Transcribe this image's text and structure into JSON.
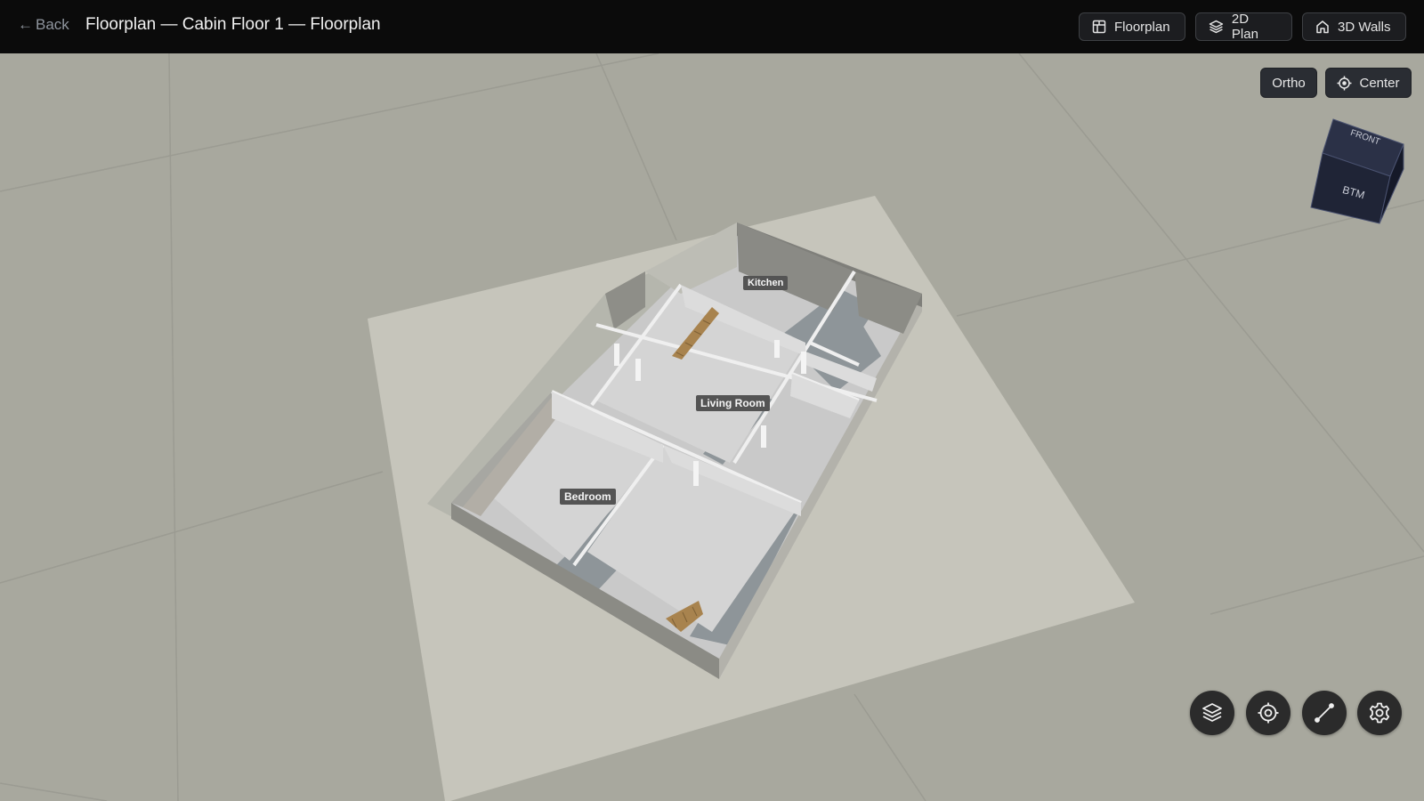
{
  "header": {
    "back_label": "Back",
    "title": "Floorplan — Cabin Floor 1 — Floorplan",
    "buttons": [
      {
        "label": "Floorplan",
        "icon": "grid-icon"
      },
      {
        "label": "2D Plan",
        "icon": "layers-icon"
      },
      {
        "label": "3D Walls",
        "icon": "home-icon"
      }
    ]
  },
  "view_controls": {
    "ortho_label": "Ortho",
    "center_label": "Center",
    "center_icon": "crosshair-icon"
  },
  "nav_cube": {
    "front_label": "FRONT",
    "bottom_label": "BTM",
    "color": "#1f2436"
  },
  "rooms": [
    {
      "name": "Kitchen"
    },
    {
      "name": "Living Room"
    },
    {
      "name": "Bedroom"
    }
  ],
  "toolbar": [
    {
      "icon": "layers-icon"
    },
    {
      "icon": "target-icon"
    },
    {
      "icon": "measure-icon"
    },
    {
      "icon": "gear-icon"
    }
  ],
  "colors": {
    "topbar": "#0b0b0b",
    "ground": "#a8a89e",
    "slab": "#c8c6bc",
    "wall": "#d6d6d6",
    "floor_shadow": "#8f9599",
    "stairs": "#a8834e",
    "fab": "#2b2b2b"
  }
}
